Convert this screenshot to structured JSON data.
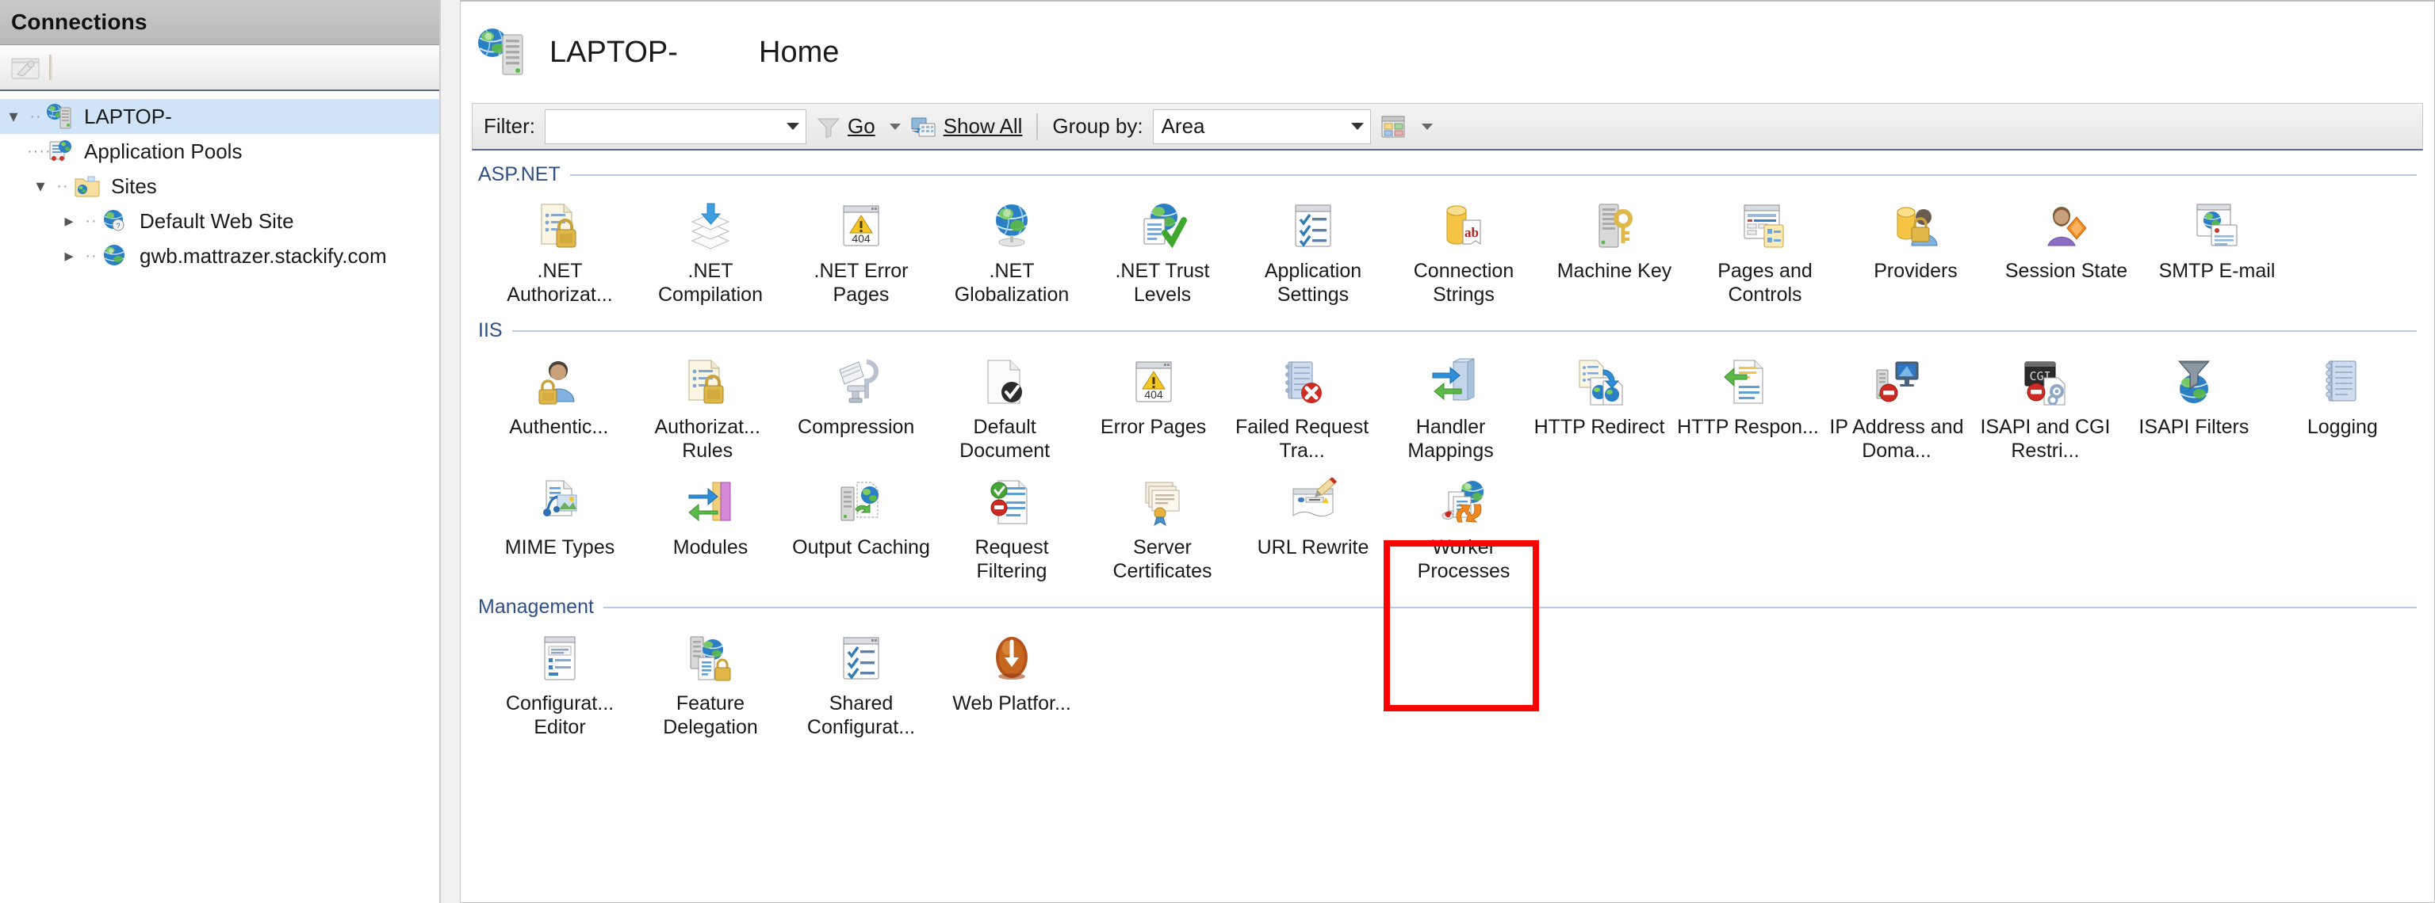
{
  "connections": {
    "header_title": "Connections",
    "toolbar": {
      "connect_icon": "connect-to-server-icon"
    },
    "tree": [
      {
        "label": "LAPTOP-",
        "icon": "server-globe-icon",
        "level": 0,
        "twisty": "expanded",
        "selected": true
      },
      {
        "label": "Application Pools",
        "icon": "application-pools-icon",
        "level": 1,
        "twisty": "none",
        "selected": false
      },
      {
        "label": "Sites",
        "icon": "sites-folder-icon",
        "level": 1,
        "twisty": "expanded",
        "selected": false
      },
      {
        "label": "Default Web Site",
        "icon": "web-site-icon",
        "level": 2,
        "twisty": "collapsed",
        "selected": false
      },
      {
        "label": "gwb.mattrazer.stackify.com",
        "icon": "web-site-globe-icon",
        "level": 2,
        "twisty": "collapsed",
        "selected": false
      }
    ]
  },
  "page": {
    "icon": "server-globe-icon",
    "server_name": "LAPTOP-",
    "title": "Home"
  },
  "filter_bar": {
    "filter_label": "Filter:",
    "filter_value": "",
    "filter_placeholder": "",
    "go_label": "Go",
    "show_all_label": "Show All",
    "group_by_label": "Group by:",
    "group_by_value": "Area",
    "view_icon": "views-icon"
  },
  "groups": [
    {
      "name": "ASP.NET",
      "rows": [
        [
          {
            "label": ".NET Authorizat...",
            "icon": "net-authorization-rules-icon"
          },
          {
            "label": ".NET Compilation",
            "icon": "net-compilation-icon"
          },
          {
            "label": ".NET Error Pages",
            "icon": "net-error-pages-icon"
          },
          {
            "label": ".NET Globalization",
            "icon": "net-globalization-icon"
          },
          {
            "label": ".NET Trust Levels",
            "icon": "net-trust-levels-icon"
          },
          {
            "label": "Application Settings",
            "icon": "application-settings-icon"
          },
          {
            "label": "Connection Strings",
            "icon": "connection-strings-icon"
          },
          {
            "label": "Machine Key",
            "icon": "machine-key-icon"
          },
          {
            "label": "Pages and Controls",
            "icon": "pages-and-controls-icon"
          },
          {
            "label": "Providers",
            "icon": "providers-icon"
          },
          {
            "label": "Session State",
            "icon": "session-state-icon"
          },
          {
            "label": "SMTP E-mail",
            "icon": "smtp-email-icon"
          }
        ]
      ]
    },
    {
      "name": "IIS",
      "rows": [
        [
          {
            "label": "Authentic...",
            "icon": "authentication-icon"
          },
          {
            "label": "Authorizat... Rules",
            "icon": "authorization-rules-icon"
          },
          {
            "label": "Compression",
            "icon": "compression-icon"
          },
          {
            "label": "Default Document",
            "icon": "default-document-icon"
          },
          {
            "label": "Error Pages",
            "icon": "error-pages-icon"
          },
          {
            "label": "Failed Request Tra...",
            "icon": "failed-request-tracing-icon"
          },
          {
            "label": "Handler Mappings",
            "icon": "handler-mappings-icon"
          },
          {
            "label": "HTTP Redirect",
            "icon": "http-redirect-icon"
          },
          {
            "label": "HTTP Respon...",
            "icon": "http-response-headers-icon"
          },
          {
            "label": "IP Address and Doma...",
            "icon": "ip-address-domain-restrictions-icon"
          },
          {
            "label": "ISAPI and CGI Restri...",
            "icon": "isapi-cgi-restrictions-icon"
          },
          {
            "label": "ISAPI Filters",
            "icon": "isapi-filters-icon"
          },
          {
            "label": "Logging",
            "icon": "logging-icon"
          }
        ],
        [
          {
            "label": "MIME Types",
            "icon": "mime-types-icon"
          },
          {
            "label": "Modules",
            "icon": "modules-icon"
          },
          {
            "label": "Output Caching",
            "icon": "output-caching-icon"
          },
          {
            "label": "Request Filtering",
            "icon": "request-filtering-icon"
          },
          {
            "label": "Server Certificates",
            "icon": "server-certificates-icon"
          },
          {
            "label": "URL Rewrite",
            "icon": "url-rewrite-icon"
          },
          {
            "label": "Worker Processes",
            "icon": "worker-processes-icon",
            "highlighted": true
          }
        ]
      ]
    },
    {
      "name": "Management",
      "rows": [
        [
          {
            "label": "Configurat... Editor",
            "icon": "configuration-editor-icon"
          },
          {
            "label": "Feature Delegation",
            "icon": "feature-delegation-icon"
          },
          {
            "label": "Shared Configurat...",
            "icon": "shared-configuration-icon"
          },
          {
            "label": "Web Platfor...",
            "icon": "web-platform-installer-icon"
          }
        ]
      ]
    }
  ],
  "highlight": {
    "target": "Worker Processes",
    "color": "#fe0000"
  }
}
